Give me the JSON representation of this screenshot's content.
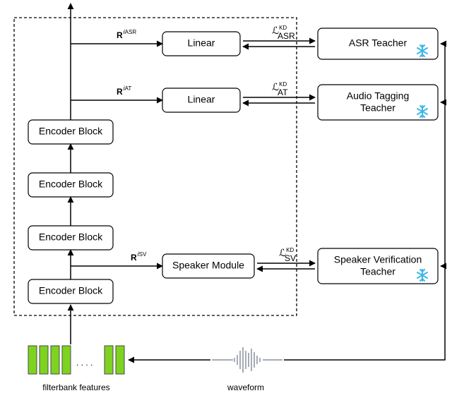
{
  "encoder": {
    "block1": "Encoder Block",
    "block2": "Encoder Block",
    "block3": "Encoder Block",
    "block4": "Encoder Block"
  },
  "linear1": "Linear",
  "linear2": "Linear",
  "speaker_module": "Speaker Module",
  "teachers": {
    "asr": "ASR Teacher",
    "at_line1": "Audio Tagging",
    "at_line2": "Teacher",
    "sv_line1": "Speaker Verification",
    "sv_line2": "Teacher"
  },
  "tap_labels": {
    "asr_R": "R",
    "asr_i": "i",
    "asr_sub": "ASR",
    "at_R": "R",
    "at_i": "i",
    "at_sub": "AT",
    "sv_R": "R",
    "sv_i": "i",
    "sv_sub": "SV"
  },
  "loss_labels": {
    "L": "ℒ",
    "kd": "KD",
    "asr": "ASR",
    "at": "AT",
    "sv": "SV"
  },
  "bottom": {
    "filterbank": "filterbank features",
    "waveform": "waveform",
    "dots": ". . . ."
  }
}
